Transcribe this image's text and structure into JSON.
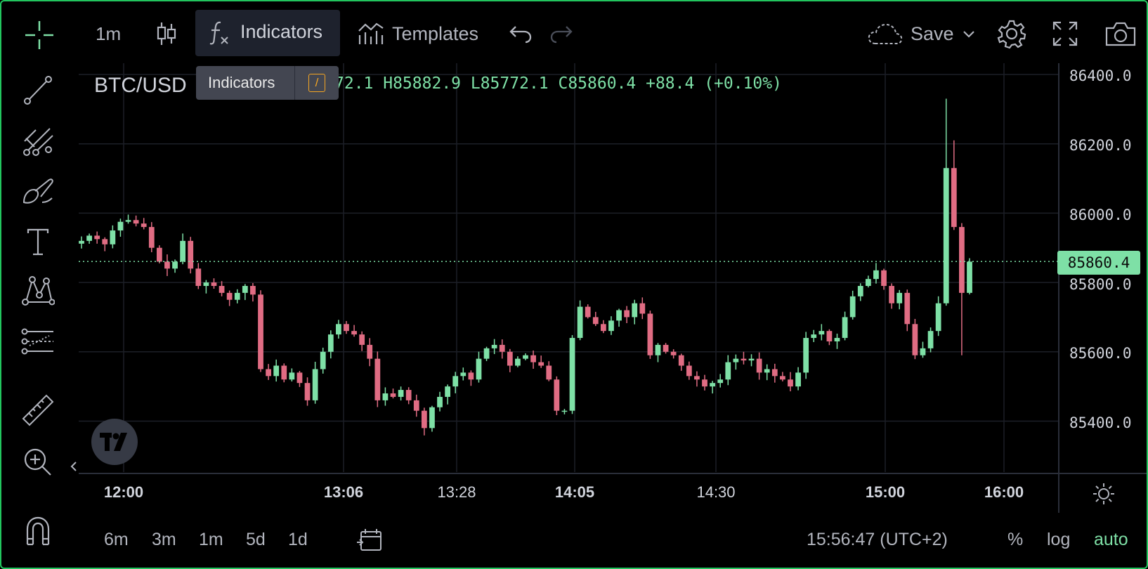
{
  "toolbar": {
    "interval": "1m",
    "indicators_label": "Indicators",
    "templates_label": "Templates",
    "save_label": "Save"
  },
  "tooltip": {
    "label": "Indicators",
    "shortcut": "/"
  },
  "legend": {
    "symbol": "BTC/USD",
    "ohlc_text": "72.1 H85882.9 L85772.1 C85860.4 +88.4 (+0.10%)"
  },
  "price_axis": {
    "labels": [
      "86400.0",
      "86200.0",
      "86000.0",
      "85800.0",
      "85600.0",
      "85400.0"
    ],
    "current_price": "85860.4"
  },
  "time_axis": {
    "labels": [
      {
        "text": "12:00",
        "bold": true
      },
      {
        "text": "13:06",
        "bold": true
      },
      {
        "text": "13:28",
        "bold": false
      },
      {
        "text": "14:05",
        "bold": true
      },
      {
        "text": "14:30",
        "bold": false
      },
      {
        "text": "15:00",
        "bold": true
      },
      {
        "text": "16:00",
        "bold": true
      }
    ]
  },
  "bottom_bar": {
    "ranges": [
      "6m",
      "3m",
      "1m",
      "5d",
      "1d"
    ],
    "time": "15:56:47 (UTC+2)",
    "percent": "%",
    "log": "log",
    "auto": "auto"
  },
  "colors": {
    "up": "#7ee0a6",
    "down": "#e06c83",
    "accent": "#22c55e",
    "background": "#000000"
  },
  "chart_data": {
    "type": "candlestick",
    "interval": "1m",
    "ylim": [
      85300,
      86500
    ],
    "yticks": [
      85400,
      85600,
      85800,
      86000,
      86200,
      86400
    ],
    "last_close": 85860.4,
    "x": [
      "11:52",
      "11:54",
      "11:56",
      "11:58",
      "12:00",
      "12:02",
      "12:04",
      "12:06",
      "12:08",
      "12:10",
      "12:12",
      "12:14",
      "12:16",
      "12:18",
      "12:20",
      "12:22",
      "12:24",
      "12:26",
      "12:28",
      "12:30",
      "12:32",
      "12:34",
      "12:36",
      "12:38",
      "12:40",
      "12:42",
      "12:44",
      "12:46",
      "12:48",
      "12:50",
      "12:52",
      "12:54",
      "12:56",
      "12:58",
      "13:00",
      "13:02",
      "13:04",
      "13:06",
      "13:08",
      "13:10",
      "13:12",
      "13:14",
      "13:16",
      "13:18",
      "13:20",
      "13:22",
      "13:24",
      "13:26",
      "13:28",
      "13:30",
      "13:32",
      "13:34",
      "13:36",
      "13:38",
      "13:40",
      "13:42",
      "13:44",
      "13:46",
      "13:48",
      "13:50",
      "13:52",
      "13:54",
      "13:56",
      "13:58",
      "14:00",
      "14:02",
      "14:04",
      "14:06",
      "14:08",
      "14:10",
      "14:12",
      "14:14",
      "14:16",
      "14:18",
      "14:20",
      "14:22",
      "14:24",
      "14:26",
      "14:28",
      "14:30",
      "14:32",
      "14:34",
      "14:36",
      "14:38",
      "14:40",
      "14:42",
      "14:44",
      "14:46",
      "14:48",
      "14:50",
      "14:52",
      "14:54",
      "14:56",
      "14:58",
      "15:00",
      "15:02",
      "15:04",
      "15:06",
      "15:08",
      "15:10",
      "15:12",
      "15:14",
      "15:16",
      "15:18",
      "15:20",
      "15:22",
      "15:24",
      "15:26",
      "15:28"
    ],
    "close": [
      85920,
      85935,
      85925,
      85910,
      85950,
      85975,
      85980,
      85970,
      85960,
      85900,
      85860,
      85840,
      85860,
      85920,
      85840,
      85790,
      85800,
      85790,
      85770,
      85750,
      85770,
      85790,
      85765,
      85550,
      85530,
      85560,
      85520,
      85540,
      85510,
      85460,
      85550,
      85600,
      85650,
      85680,
      85660,
      85650,
      85620,
      85580,
      85460,
      85480,
      85470,
      85490,
      85460,
      85430,
      85380,
      85440,
      85470,
      85500,
      85530,
      85540,
      85520,
      85580,
      85610,
      85620,
      85600,
      85560,
      85580,
      85590,
      85570,
      85560,
      85520,
      85430,
      85430,
      85640,
      85730,
      85700,
      85680,
      85660,
      85690,
      85720,
      85700,
      85740,
      85710,
      85590,
      85620,
      85600,
      85590,
      85560,
      85530,
      85520,
      85500,
      85510,
      85520,
      85570,
      85580,
      85575,
      85580,
      85540,
      85550,
      85530,
      85520,
      85500,
      85540,
      85640,
      85650,
      85660,
      85630,
      85640,
      85700,
      85760,
      85790,
      85810,
      85835,
      85790,
      85740,
      85770,
      85680,
      85590,
      85610,
      85660,
      85740,
      86130,
      85960,
      85770,
      85860
    ]
  }
}
